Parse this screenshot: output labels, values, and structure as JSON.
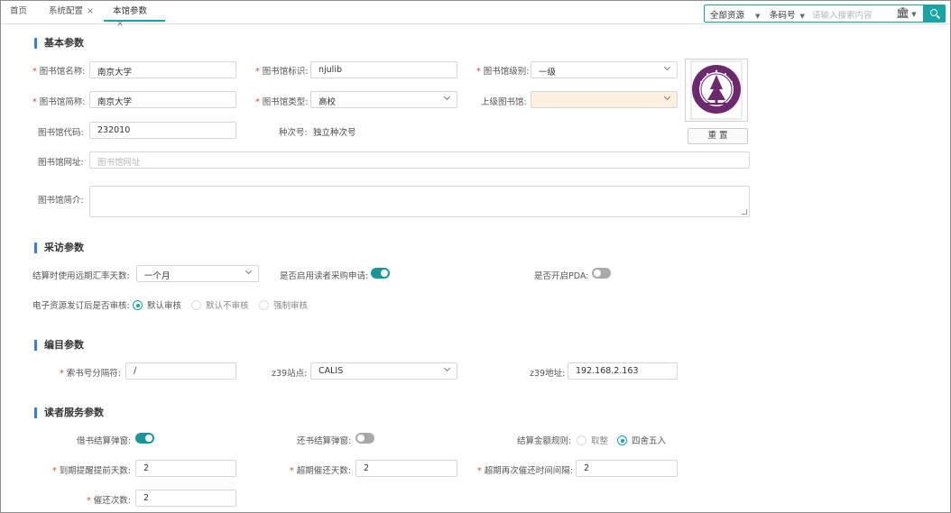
{
  "tabs": [
    {
      "label": "首页"
    },
    {
      "label": "系统配置",
      "close": "×"
    },
    {
      "label": "本馆参数",
      "close": "×"
    }
  ],
  "search": {
    "scope": "全部资源",
    "field": "条码号",
    "placeholder": "请输入搜索内容",
    "icon": "search-icon"
  },
  "sections": {
    "basic": "基本参数",
    "acq": "采访参数",
    "cat": "编目参数",
    "reader": "读者服务参数"
  },
  "basic": {
    "name_label": "图书馆名称:",
    "name_value": "南京大学",
    "id_label": "图书馆标识:",
    "id_value": "njulib",
    "level_label": "图书馆级别:",
    "level_value": "一级",
    "short_label": "图书馆简称:",
    "short_value": "南京大学",
    "type_label": "图书馆类型:",
    "type_value": "高校",
    "parent_label": "上级图书馆:",
    "parent_value": "",
    "code_label": "图书馆代码:",
    "code_value": "232010",
    "seq_label": "种次号:",
    "seq_value": "独立种次号",
    "url_label": "图书馆网址:",
    "url_placeholder": "图书馆网址",
    "intro_label": "图书馆简介:",
    "reset_label": "重 置"
  },
  "acq": {
    "rate_label": "结算时使用远期汇率天数:",
    "rate_value": "一个月",
    "reader_purchase_label": "是否启用读者采购申请:",
    "reader_purchase_on": true,
    "pda_label": "是否开启PDA:",
    "pda_on": false,
    "eres_label": "电子资源发订后是否审核:",
    "eres_options": [
      "默认审核",
      "默认不审核",
      "强制审核"
    ],
    "eres_selected": "默认审核"
  },
  "cat": {
    "sep_label": "索书号分隔符:",
    "sep_value": "/",
    "z39site_label": "z39站点:",
    "z39site_value": "CALIS",
    "z39addr_label": "z39地址:",
    "z39addr_value": "192.168.2.163"
  },
  "reader": {
    "borrow_popup_label": "借书结算弹窗:",
    "borrow_popup_on": true,
    "return_popup_label": "还书结算弹窗:",
    "return_popup_on": false,
    "amount_rule_label": "结算金额规则:",
    "amount_rule_options": [
      "取整",
      "四舍五入"
    ],
    "amount_rule_selected": "四舍五入",
    "due_remind_label": "到期提醒提前天数:",
    "due_remind_value": "2",
    "overdue_days_label": "超期催还天数:",
    "overdue_days_value": "2",
    "overdue_interval_label": "超期再次催还时间间隔:",
    "overdue_interval_value": "2",
    "remind_count_label": "催还次数:",
    "remind_count_value": "2"
  },
  "colors": {
    "accent": "#1aa3a3",
    "section_bar": "#3b7fd1",
    "required": "#e04040",
    "logo_purple": "#6b2a6e"
  }
}
